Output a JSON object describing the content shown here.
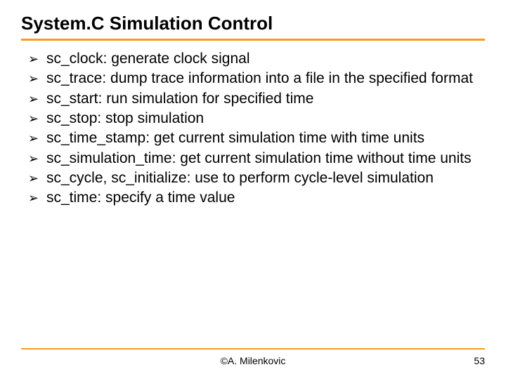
{
  "title": "System.C Simulation Control",
  "bullets": [
    "sc_clock: generate clock signal",
    "sc_trace: dump trace information into a file in the specified format",
    "sc_start: run simulation for specified time",
    "sc_stop: stop simulation",
    "sc_time_stamp: get current simulation time with time units",
    "sc_simulation_time: get current simulation time without time units",
    "sc_cycle, sc_initialize: use to perform cycle-level simulation",
    "sc_time: specify a time value"
  ],
  "footer": {
    "author": "©A. Milenkovic",
    "page": "53"
  }
}
